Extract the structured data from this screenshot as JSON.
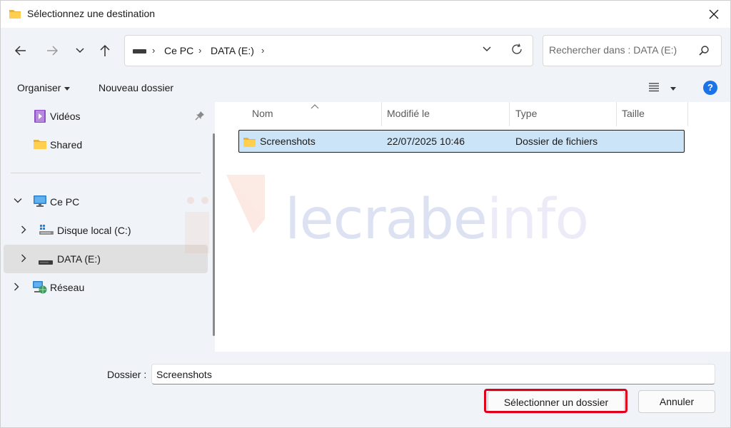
{
  "window": {
    "title": "Sélectionnez une destination"
  },
  "address": {
    "crumbs": [
      "Ce PC",
      "DATA (E:)"
    ],
    "search_placeholder": "Rechercher dans : DATA (E:)"
  },
  "toolbar": {
    "organize_label": "Organiser",
    "new_folder_label": "Nouveau dossier",
    "help_label": "?"
  },
  "nav": {
    "items": [
      {
        "label": "Vidéos"
      },
      {
        "label": "Shared"
      },
      {
        "label": "Ce PC"
      },
      {
        "label": "Disque local (C:)"
      },
      {
        "label": "DATA (E:)"
      },
      {
        "label": "Réseau"
      }
    ]
  },
  "columns": {
    "name": "Nom",
    "modified": "Modifié le",
    "type": "Type",
    "size": "Taille"
  },
  "rows": [
    {
      "name": "Screenshots",
      "modified": "22/07/2025 10:46",
      "type": "Dossier de fichiers",
      "size": ""
    }
  ],
  "watermark": {
    "part1": "lecrabe",
    "part2": "info"
  },
  "footer": {
    "folder_label": "Dossier :",
    "folder_value": "Screenshots",
    "select_button": "Sélectionner un dossier",
    "cancel_button": "Annuler"
  },
  "colors": {
    "accent": "#1a73e8",
    "selection": "#cce4f7",
    "highlight": "#e0001b",
    "pane": "#f0f4f9"
  }
}
